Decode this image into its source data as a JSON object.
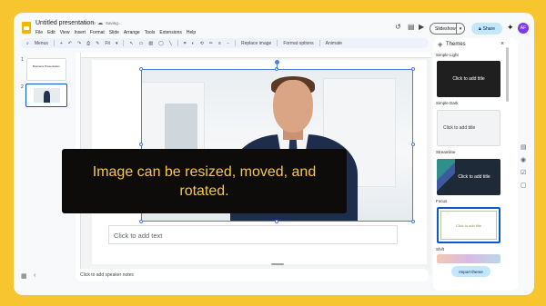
{
  "app": {
    "doc_title": "Untitled presentation",
    "saving_status": "Saving...",
    "menu": [
      "File",
      "Edit",
      "View",
      "Insert",
      "Format",
      "Slide",
      "Arrange",
      "Tools",
      "Extensions",
      "Help"
    ]
  },
  "header": {
    "slideshow_label": "Slideshow",
    "share_label": "Share",
    "avatar_initials": "AF"
  },
  "toolbar": {
    "search_menus": "Menus",
    "zoom": "Fit",
    "replace_image": "Replace image",
    "format_options": "Format options",
    "animate": "Animate"
  },
  "filmstrip": {
    "slides": [
      {
        "number": "1",
        "thumb_text": "Business Presentation"
      },
      {
        "number": "2",
        "thumb_text": ""
      }
    ]
  },
  "slide": {
    "placeholder_text": "Click to add text"
  },
  "caption": {
    "text": "Image can be resized, moved, and rotated."
  },
  "notes": {
    "placeholder": "Click to add speaker notes"
  },
  "themes_panel": {
    "title": "Themes",
    "themes": [
      {
        "name": "Simple Light",
        "card_text": "Click to add title",
        "bg": "#1f1f1f",
        "fg": "#ffffff"
      },
      {
        "name": "Simple Dark",
        "card_text": "Click to add title",
        "bg": "#f1f3f4",
        "fg": "#3c4043"
      },
      {
        "name": "Streamline",
        "card_text": "Click to add title",
        "bg": "#1e2a38",
        "fg": "#ffffff"
      },
      {
        "name": "Focus",
        "card_text": "Click to add title",
        "bg": "#ffffff",
        "fg": "#7a9c4a"
      },
      {
        "name": "Shift",
        "card_text": "",
        "bg": "#ffffff",
        "fg": "#1f1f1f"
      }
    ],
    "import_label": "Import theme"
  },
  "colors": {
    "background": "#f6c530",
    "accent": "#0b57d0",
    "caption_bg": "#0d0c0a",
    "caption_text": "#f7c748",
    "share_bg": "#c2e7ff"
  },
  "icons": [
    "slides-logo-icon",
    "star-icon",
    "folder-icon",
    "cloud-icon",
    "history-icon",
    "comment-icon",
    "video-icon",
    "sparkle-icon",
    "close-icon",
    "grid-icon",
    "collapse-icon"
  ]
}
